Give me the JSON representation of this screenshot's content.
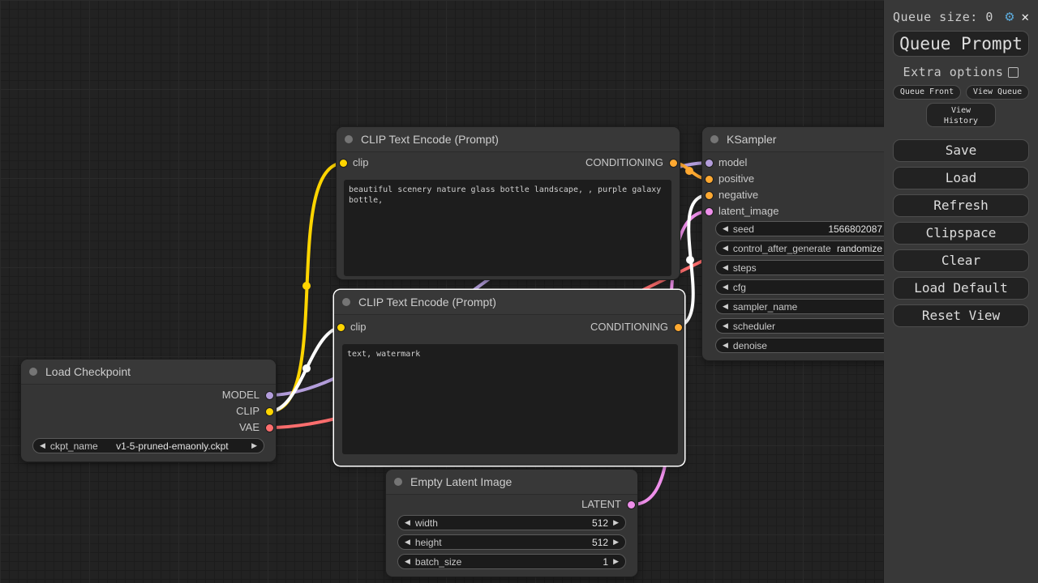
{
  "colors": {
    "model": "#B39DDB",
    "clip": "#FFD500",
    "vae": "#FF6E6E",
    "conditioning": "#FFA931",
    "latent": "#EE8FEA",
    "selected_link": "#FFFFFF",
    "gear_blue": "#5BA7D6"
  },
  "icons": {
    "left_arrow": "◀",
    "right_arrow": "▶",
    "gear": "⚙",
    "close": "✕"
  },
  "sidebar": {
    "queue_size": "Queue size: 0",
    "queue_prompt": "Queue Prompt",
    "extra_options": "Extra options",
    "queue_front": "Queue Front",
    "view_queue": "View Queue",
    "view_history": "View\nHistory",
    "save": "Save",
    "load": "Load",
    "refresh": "Refresh",
    "clipspace": "Clipspace",
    "clear": "Clear",
    "load_default": "Load Default",
    "reset_view": "Reset View"
  },
  "nodes": {
    "load_checkpoint": {
      "title": "Load Checkpoint",
      "outputs": [
        "MODEL",
        "CLIP",
        "VAE"
      ],
      "widget": {
        "label": "ckpt_name",
        "value": "v1-5-pruned-emaonly.ckpt"
      }
    },
    "clip_positive": {
      "title": "CLIP Text Encode (Prompt)",
      "input": "clip",
      "output": "CONDITIONING",
      "text": "beautiful scenery nature glass bottle landscape, , purple galaxy bottle,"
    },
    "clip_negative": {
      "title": "CLIP Text Encode (Prompt)",
      "input": "clip",
      "output": "CONDITIONING",
      "text": "text, watermark"
    },
    "ksampler": {
      "title": "KSampler",
      "inputs": [
        "model",
        "positive",
        "negative",
        "latent_image"
      ],
      "widgets": [
        {
          "label": "seed",
          "value": "1566802087"
        },
        {
          "label": "control_after_generate",
          "value": "randomize"
        },
        {
          "label": "steps",
          "value": ""
        },
        {
          "label": "cfg",
          "value": ""
        },
        {
          "label": "sampler_name",
          "value": ""
        },
        {
          "label": "scheduler",
          "value": ""
        },
        {
          "label": "denoise",
          "value": ""
        }
      ]
    },
    "empty_latent": {
      "title": "Empty Latent Image",
      "output": "LATENT",
      "widgets": [
        {
          "label": "width",
          "value": "512"
        },
        {
          "label": "height",
          "value": "512"
        },
        {
          "label": "batch_size",
          "value": "1"
        }
      ]
    }
  }
}
